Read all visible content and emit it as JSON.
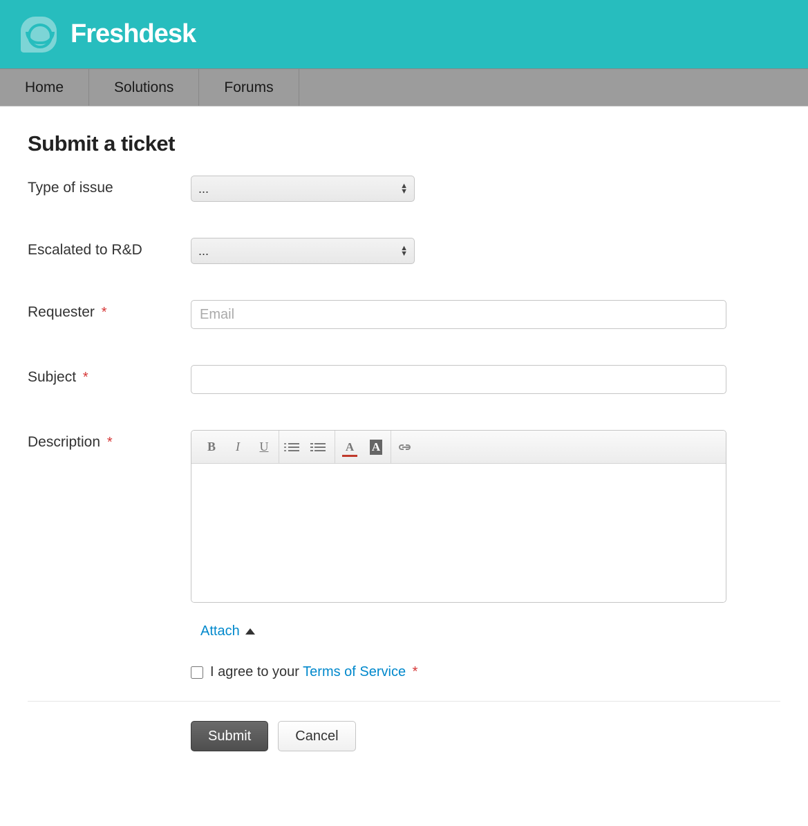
{
  "brand": "Freshdesk",
  "nav": {
    "items": [
      "Home",
      "Solutions",
      "Forums"
    ]
  },
  "page": {
    "title": "Submit a ticket"
  },
  "form": {
    "type_label": "Type of issue",
    "type_value": "...",
    "esc_label": "Escalated to R&D",
    "esc_value": "...",
    "requester_label": "Requester",
    "requester_placeholder": "Email",
    "subject_label": "Subject",
    "description_label": "Description",
    "attach_label": "Attach",
    "tos_prefix": "I agree to your ",
    "tos_link": "Terms of Service",
    "submit_label": "Submit",
    "cancel_label": "Cancel",
    "required_marker": "*"
  },
  "toolbar": {
    "bold": "B",
    "italic": "I",
    "underline": "U",
    "textcolor": "A",
    "bgcolor": "A"
  }
}
